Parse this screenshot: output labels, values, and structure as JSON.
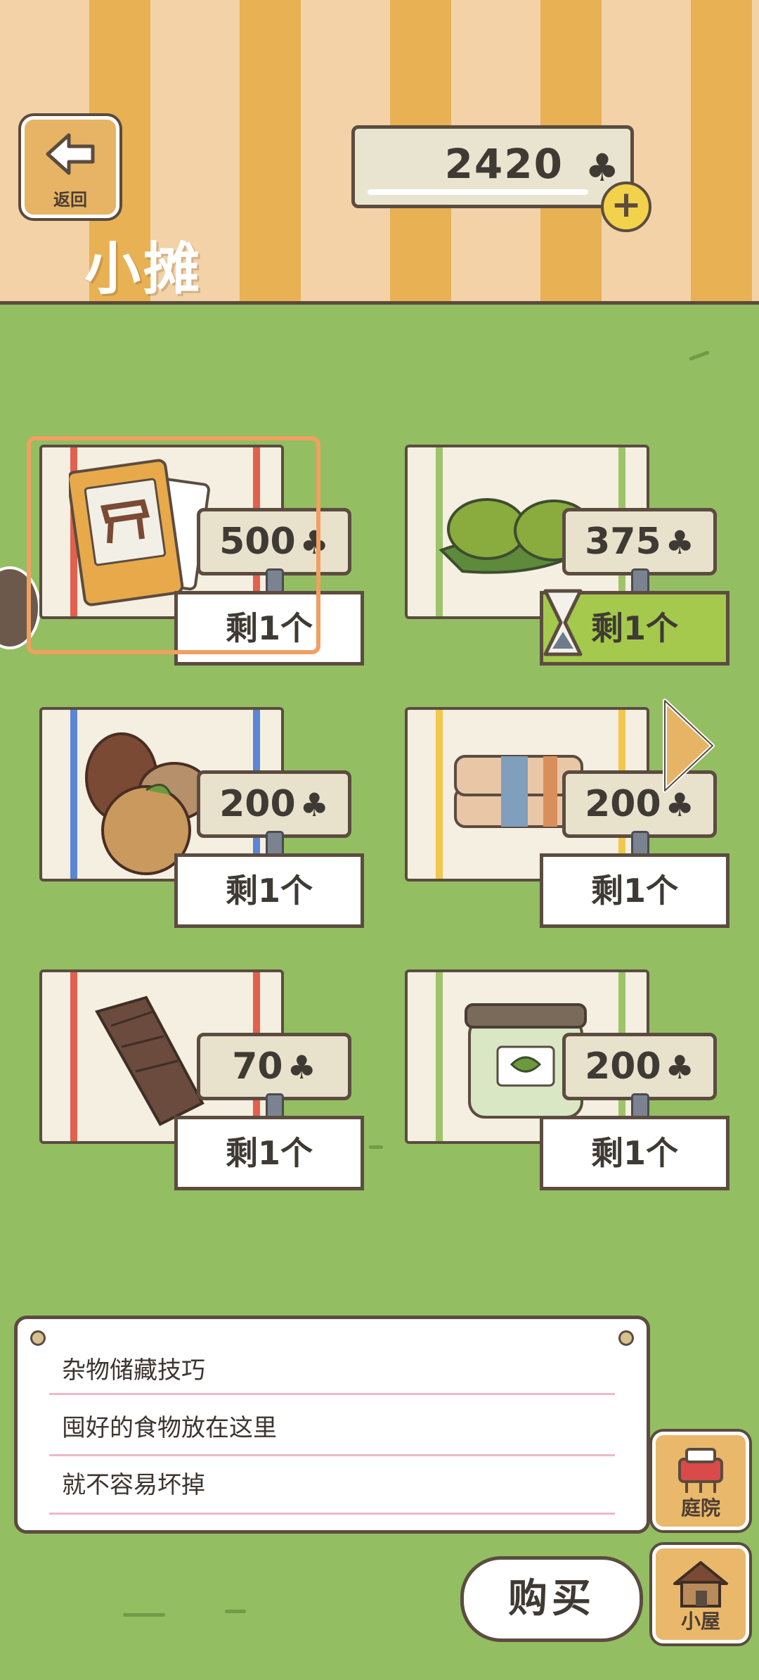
{
  "header": {
    "back_label": "返回",
    "title": "小摊",
    "clovers": "2420",
    "clover_icon": "♣",
    "plus_icon": "+"
  },
  "shop": {
    "items": [
      {
        "price": "500",
        "stock": "剩1个",
        "icon": "furniture-card-icon"
      },
      {
        "price": "375",
        "stock": "剩1个",
        "icon": "mochi-icon"
      },
      {
        "price": "200",
        "stock": "剩1个",
        "icon": "pinecone-citrus-icon"
      },
      {
        "price": "200",
        "stock": "剩1个",
        "icon": "blanket-icon"
      },
      {
        "price": "70",
        "stock": "剩1个",
        "icon": "wood-bark-icon"
      },
      {
        "price": "200",
        "stock": "剩1个",
        "icon": "jar-icon"
      }
    ]
  },
  "note": {
    "line1": "杂物储藏技巧",
    "line2": "囤好的食物放在这里",
    "line3": "就不容易坏掉"
  },
  "actions": {
    "buy_label": "购买",
    "yard_label": "庭院",
    "house_label": "小屋"
  },
  "colors": {
    "grass": "#93be62",
    "stripe_light": "#f3d2a8",
    "stripe_dark": "#e8b154",
    "outline": "#5c4c40",
    "selected": "#f0a060",
    "sale_tag": "#a4c94d"
  }
}
